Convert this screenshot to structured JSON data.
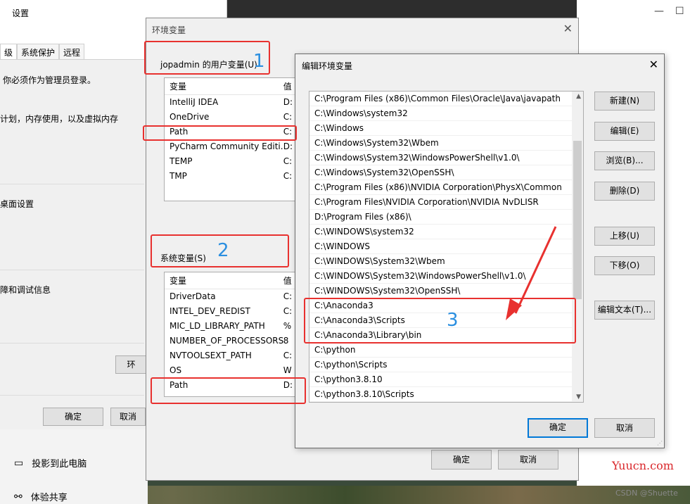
{
  "settings": {
    "title": "设置",
    "tabs": [
      "级",
      "系统保护",
      "远程"
    ],
    "admin_note": "你必须作为管理员登录。",
    "perf_text": "计划，内存使用，以及虚拟内存",
    "desktop_text": "桌面设置",
    "debug_text": "障和调试信息",
    "env_button": "环",
    "ok": "确定",
    "cancel": "取消",
    "bottom_items": [
      {
        "label": "投影到此电脑",
        "icon": "monitor-icon"
      },
      {
        "label": "体验共享",
        "icon": "share-icon"
      }
    ]
  },
  "env": {
    "title": "环境变量",
    "user_group": "jopadmin 的用户变量(U)",
    "user_headers": [
      "变量",
      "值"
    ],
    "user_vars": [
      {
        "name": "IntelliJ IDEA",
        "value": "D:"
      },
      {
        "name": "OneDrive",
        "value": "C:"
      },
      {
        "name": "Path",
        "value": "C:"
      },
      {
        "name": "PyCharm Community Editi...",
        "value": "D:"
      },
      {
        "name": "TEMP",
        "value": "C:"
      },
      {
        "name": "TMP",
        "value": "C:"
      }
    ],
    "system_group": "系统变量(S)",
    "system_headers": [
      "变量",
      "值"
    ],
    "system_vars": [
      {
        "name": "DriverData",
        "value": "C:"
      },
      {
        "name": "INTEL_DEV_REDIST",
        "value": "C:"
      },
      {
        "name": "MIC_LD_LIBRARY_PATH",
        "value": "%"
      },
      {
        "name": "NUMBER_OF_PROCESSORS",
        "value": "8"
      },
      {
        "name": "NVTOOLSEXT_PATH",
        "value": "C:"
      },
      {
        "name": "OS",
        "value": "W"
      },
      {
        "name": "Path",
        "value": "D:"
      }
    ],
    "ok": "确定",
    "cancel": "取消"
  },
  "edit": {
    "title": "编辑环境变量",
    "paths": [
      "C:\\Program Files (x86)\\Common Files\\Oracle\\Java\\javapath",
      "C:\\Windows\\system32",
      "C:\\Windows",
      "C:\\Windows\\System32\\Wbem",
      "C:\\Windows\\System32\\WindowsPowerShell\\v1.0\\",
      "C:\\Windows\\System32\\OpenSSH\\",
      "C:\\Program Files (x86)\\NVIDIA Corporation\\PhysX\\Common",
      "C:\\Program Files\\NVIDIA Corporation\\NVIDIA NvDLISR",
      "D:\\Program Files (x86)\\",
      "C:\\WINDOWS\\system32",
      "C:\\WINDOWS",
      "C:\\WINDOWS\\System32\\Wbem",
      "C:\\WINDOWS\\System32\\WindowsPowerShell\\v1.0\\",
      "C:\\WINDOWS\\System32\\OpenSSH\\",
      "C:\\Anaconda3",
      "C:\\Anaconda3\\Scripts",
      "C:\\Anaconda3\\Library\\bin",
      "C:\\python",
      "C:\\python\\Scripts",
      "C:\\python3.8.10",
      "C:\\python3.8.10\\Scripts"
    ],
    "buttons": {
      "new": "新建(N)",
      "edit": "编辑(E)",
      "browse": "浏览(B)...",
      "delete": "删除(D)",
      "up": "上移(U)",
      "down": "下移(O)",
      "edit_text": "编辑文本(T)..."
    },
    "ok": "确定",
    "cancel": "取消"
  },
  "annotations": {
    "n1": "1",
    "n2": "2",
    "n3": "3",
    "color": "#e8312f"
  },
  "watermark": {
    "site": "Yuucn.com",
    "csdn": "CSDN @Shuette"
  }
}
